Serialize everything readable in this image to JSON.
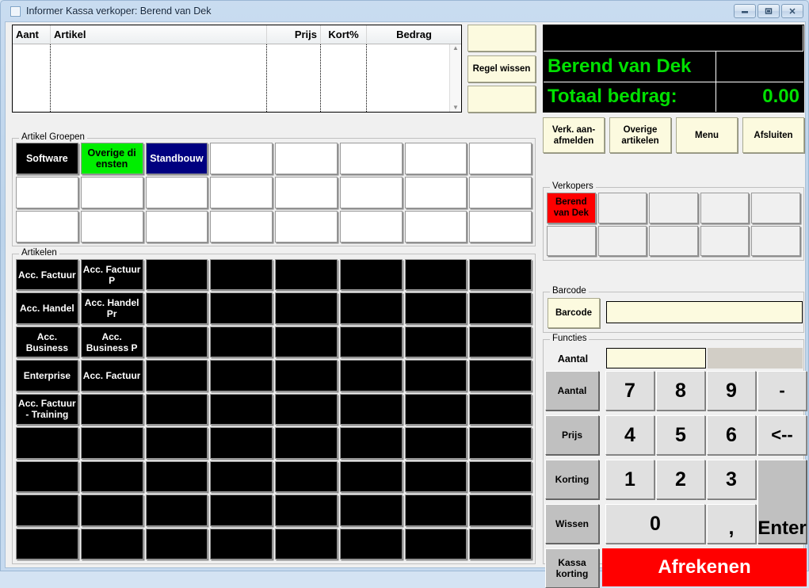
{
  "window": {
    "title": "Informer Kassa  verkoper: Berend van Dek",
    "minimize": "minimize-icon",
    "restore": "restore-icon",
    "close": "close-icon"
  },
  "receipt_grid": {
    "columns": [
      "Aant",
      "Artikel",
      "Prijs",
      "Kort%",
      "Bedrag"
    ],
    "rows": []
  },
  "nav": {
    "up_label": "",
    "clear_line_label": "Regel wissen",
    "down_label": ""
  },
  "display": {
    "blank_line": "",
    "seller_name": "Berend van Dek",
    "seller_value": "",
    "total_label": "Totaal bedrag:",
    "total_value": "0.00"
  },
  "top_buttons": [
    {
      "label": "Verk. aan-\nafmelden"
    },
    {
      "label": "Overige\nartikelen"
    },
    {
      "label": "Menu"
    },
    {
      "label": "Afsluiten"
    }
  ],
  "artikel_groepen": {
    "legend": "Artikel Groepen",
    "columns": 8,
    "rows": 3,
    "tiles": [
      {
        "label": "Software",
        "bg": "#000000",
        "fg": "#ffffff"
      },
      {
        "label": "Overige di ensten",
        "bg": "#00ee00",
        "fg": "#000000"
      },
      {
        "label": "Standbouw",
        "bg": "#000080",
        "fg": "#ffffff"
      },
      {
        "label": "",
        "bg": "#ffffff",
        "fg": "#000000"
      },
      {
        "label": "",
        "bg": "#ffffff",
        "fg": "#000000"
      },
      {
        "label": "",
        "bg": "#ffffff",
        "fg": "#000000"
      },
      {
        "label": "",
        "bg": "#ffffff",
        "fg": "#000000"
      },
      {
        "label": "",
        "bg": "#ffffff",
        "fg": "#000000"
      },
      {
        "label": "",
        "bg": "#ffffff",
        "fg": "#000000"
      },
      {
        "label": "",
        "bg": "#ffffff",
        "fg": "#000000"
      },
      {
        "label": "",
        "bg": "#ffffff",
        "fg": "#000000"
      },
      {
        "label": "",
        "bg": "#ffffff",
        "fg": "#000000"
      },
      {
        "label": "",
        "bg": "#ffffff",
        "fg": "#000000"
      },
      {
        "label": "",
        "bg": "#ffffff",
        "fg": "#000000"
      },
      {
        "label": "",
        "bg": "#ffffff",
        "fg": "#000000"
      },
      {
        "label": "",
        "bg": "#ffffff",
        "fg": "#000000"
      },
      {
        "label": "",
        "bg": "#ffffff",
        "fg": "#000000"
      },
      {
        "label": "",
        "bg": "#ffffff",
        "fg": "#000000"
      },
      {
        "label": "",
        "bg": "#ffffff",
        "fg": "#000000"
      },
      {
        "label": "",
        "bg": "#ffffff",
        "fg": "#000000"
      },
      {
        "label": "",
        "bg": "#ffffff",
        "fg": "#000000"
      },
      {
        "label": "",
        "bg": "#ffffff",
        "fg": "#000000"
      },
      {
        "label": "",
        "bg": "#ffffff",
        "fg": "#000000"
      },
      {
        "label": "",
        "bg": "#ffffff",
        "fg": "#000000"
      }
    ]
  },
  "artikelen": {
    "legend": "Artikelen",
    "columns": 8,
    "rows": 9,
    "tiles": [
      {
        "label": "Acc. Factuur",
        "bg": "#000000",
        "fg": "#ffffff"
      },
      {
        "label": "Acc. Factuur P",
        "bg": "#000000",
        "fg": "#ffffff"
      },
      {
        "label": "",
        "bg": "#000000",
        "fg": "#ffffff"
      },
      {
        "label": "",
        "bg": "#000000",
        "fg": "#ffffff"
      },
      {
        "label": "",
        "bg": "#000000",
        "fg": "#ffffff"
      },
      {
        "label": "",
        "bg": "#000000",
        "fg": "#ffffff"
      },
      {
        "label": "",
        "bg": "#000000",
        "fg": "#ffffff"
      },
      {
        "label": "",
        "bg": "#000000",
        "fg": "#ffffff"
      },
      {
        "label": "Acc. Handel",
        "bg": "#000000",
        "fg": "#ffffff"
      },
      {
        "label": "Acc. Handel Pr",
        "bg": "#000000",
        "fg": "#ffffff"
      },
      {
        "label": "",
        "bg": "#000000",
        "fg": "#ffffff"
      },
      {
        "label": "",
        "bg": "#000000",
        "fg": "#ffffff"
      },
      {
        "label": "",
        "bg": "#000000",
        "fg": "#ffffff"
      },
      {
        "label": "",
        "bg": "#000000",
        "fg": "#ffffff"
      },
      {
        "label": "",
        "bg": "#000000",
        "fg": "#ffffff"
      },
      {
        "label": "",
        "bg": "#000000",
        "fg": "#ffffff"
      },
      {
        "label": "Acc. Business",
        "bg": "#000000",
        "fg": "#ffffff"
      },
      {
        "label": "Acc. Business P",
        "bg": "#000000",
        "fg": "#ffffff"
      },
      {
        "label": "",
        "bg": "#000000",
        "fg": "#ffffff"
      },
      {
        "label": "",
        "bg": "#000000",
        "fg": "#ffffff"
      },
      {
        "label": "",
        "bg": "#000000",
        "fg": "#ffffff"
      },
      {
        "label": "",
        "bg": "#000000",
        "fg": "#ffffff"
      },
      {
        "label": "",
        "bg": "#000000",
        "fg": "#ffffff"
      },
      {
        "label": "",
        "bg": "#000000",
        "fg": "#ffffff"
      },
      {
        "label": "Enterprise",
        "bg": "#000000",
        "fg": "#ffffff"
      },
      {
        "label": "Acc. Factuur",
        "bg": "#000000",
        "fg": "#ffffff"
      },
      {
        "label": "",
        "bg": "#000000",
        "fg": "#ffffff"
      },
      {
        "label": "",
        "bg": "#000000",
        "fg": "#ffffff"
      },
      {
        "label": "",
        "bg": "#000000",
        "fg": "#ffffff"
      },
      {
        "label": "",
        "bg": "#000000",
        "fg": "#ffffff"
      },
      {
        "label": "",
        "bg": "#000000",
        "fg": "#ffffff"
      },
      {
        "label": "",
        "bg": "#000000",
        "fg": "#ffffff"
      },
      {
        "label": "Acc. Factuur - Training",
        "bg": "#000000",
        "fg": "#ffffff"
      },
      {
        "label": "",
        "bg": "#000000",
        "fg": "#ffffff"
      },
      {
        "label": "",
        "bg": "#000000",
        "fg": "#ffffff"
      },
      {
        "label": "",
        "bg": "#000000",
        "fg": "#ffffff"
      },
      {
        "label": "",
        "bg": "#000000",
        "fg": "#ffffff"
      },
      {
        "label": "",
        "bg": "#000000",
        "fg": "#ffffff"
      },
      {
        "label": "",
        "bg": "#000000",
        "fg": "#ffffff"
      },
      {
        "label": "",
        "bg": "#000000",
        "fg": "#ffffff"
      },
      {
        "label": "",
        "bg": "#000000",
        "fg": "#ffffff"
      },
      {
        "label": "",
        "bg": "#000000",
        "fg": "#ffffff"
      },
      {
        "label": "",
        "bg": "#000000",
        "fg": "#ffffff"
      },
      {
        "label": "",
        "bg": "#000000",
        "fg": "#ffffff"
      },
      {
        "label": "",
        "bg": "#000000",
        "fg": "#ffffff"
      },
      {
        "label": "",
        "bg": "#000000",
        "fg": "#ffffff"
      },
      {
        "label": "",
        "bg": "#000000",
        "fg": "#ffffff"
      },
      {
        "label": "",
        "bg": "#000000",
        "fg": "#ffffff"
      },
      {
        "label": "",
        "bg": "#000000",
        "fg": "#ffffff"
      },
      {
        "label": "",
        "bg": "#000000",
        "fg": "#ffffff"
      },
      {
        "label": "",
        "bg": "#000000",
        "fg": "#ffffff"
      },
      {
        "label": "",
        "bg": "#000000",
        "fg": "#ffffff"
      },
      {
        "label": "",
        "bg": "#000000",
        "fg": "#ffffff"
      },
      {
        "label": "",
        "bg": "#000000",
        "fg": "#ffffff"
      },
      {
        "label": "",
        "bg": "#000000",
        "fg": "#ffffff"
      },
      {
        "label": "",
        "bg": "#000000",
        "fg": "#ffffff"
      },
      {
        "label": "",
        "bg": "#000000",
        "fg": "#ffffff"
      },
      {
        "label": "",
        "bg": "#000000",
        "fg": "#ffffff"
      },
      {
        "label": "",
        "bg": "#000000",
        "fg": "#ffffff"
      },
      {
        "label": "",
        "bg": "#000000",
        "fg": "#ffffff"
      },
      {
        "label": "",
        "bg": "#000000",
        "fg": "#ffffff"
      },
      {
        "label": "",
        "bg": "#000000",
        "fg": "#ffffff"
      },
      {
        "label": "",
        "bg": "#000000",
        "fg": "#ffffff"
      },
      {
        "label": "",
        "bg": "#000000",
        "fg": "#ffffff"
      },
      {
        "label": "",
        "bg": "#000000",
        "fg": "#ffffff"
      },
      {
        "label": "",
        "bg": "#000000",
        "fg": "#ffffff"
      },
      {
        "label": "",
        "bg": "#000000",
        "fg": "#ffffff"
      },
      {
        "label": "",
        "bg": "#000000",
        "fg": "#ffffff"
      },
      {
        "label": "",
        "bg": "#000000",
        "fg": "#ffffff"
      },
      {
        "label": "",
        "bg": "#000000",
        "fg": "#ffffff"
      },
      {
        "label": "",
        "bg": "#000000",
        "fg": "#ffffff"
      },
      {
        "label": "",
        "bg": "#000000",
        "fg": "#ffffff"
      }
    ]
  },
  "verkopers": {
    "legend": "Verkopers",
    "columns": 5,
    "rows": 2,
    "tiles": [
      {
        "label": "Berend van Dek",
        "bg": "#ff0000",
        "fg": "#000000"
      },
      {
        "label": "",
        "bg": "#f0f0f0",
        "fg": "#000000"
      },
      {
        "label": "",
        "bg": "#f0f0f0",
        "fg": "#000000"
      },
      {
        "label": "",
        "bg": "#f0f0f0",
        "fg": "#000000"
      },
      {
        "label": "",
        "bg": "#f0f0f0",
        "fg": "#000000"
      },
      {
        "label": "",
        "bg": "#f0f0f0",
        "fg": "#000000"
      },
      {
        "label": "",
        "bg": "#f0f0f0",
        "fg": "#000000"
      },
      {
        "label": "",
        "bg": "#f0f0f0",
        "fg": "#000000"
      },
      {
        "label": "",
        "bg": "#f0f0f0",
        "fg": "#000000"
      },
      {
        "label": "",
        "bg": "#f0f0f0",
        "fg": "#000000"
      }
    ]
  },
  "barcode": {
    "legend": "Barcode",
    "button_label": "Barcode",
    "input_value": "",
    "input_placeholder": ""
  },
  "functies": {
    "legend": "Functies",
    "aantal_label": "Aantal",
    "aantal_value": "",
    "aantal_secondary": "",
    "side_buttons": [
      "Aantal",
      "Prijs",
      "Korting",
      "Wissen",
      "Kassa korting"
    ],
    "keys": [
      "7",
      "8",
      "9",
      "-",
      "4",
      "5",
      "6",
      "<--",
      "1",
      "2",
      "3"
    ],
    "zero_label": "0",
    "comma_label": ",",
    "enter_label": "Enter",
    "pay_label": "Afrekenen"
  },
  "colors": {
    "accent_green": "#00e000",
    "cream": "#fcfadf",
    "pay_red": "#ff0000",
    "seller_red": "#ff0000",
    "group_green": "#00ee00",
    "group_navy": "#000080"
  }
}
